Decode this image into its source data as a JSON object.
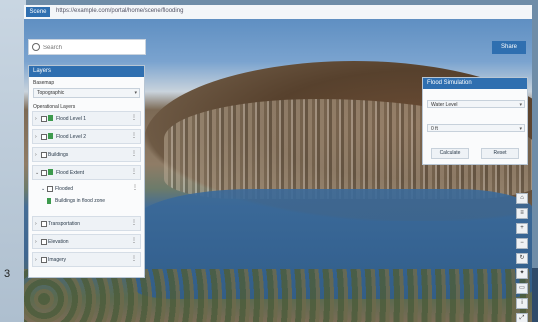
{
  "page_number": "3",
  "browser": {
    "nav_chip": "Scene",
    "url": "https://example.com/portal/home/scene/flooding"
  },
  "search": {
    "placeholder": "Search",
    "value": ""
  },
  "layers_panel": {
    "title": "Layers",
    "basemap_label": "Basemap",
    "basemap_value": "Topographic",
    "operational_label": "Operational Layers",
    "layers": [
      {
        "label": "Flood Level 1"
      },
      {
        "label": "Flood Level 2"
      },
      {
        "label": "Buildings"
      },
      {
        "label": "Flood Extent"
      }
    ],
    "sublayer": {
      "label": "Flooded"
    },
    "legend_text": "Buildings in flood zone",
    "more_layers": [
      {
        "label": "Transportation"
      },
      {
        "label": "Elevation"
      },
      {
        "label": "Imagery"
      }
    ]
  },
  "top_button": {
    "label": "Share"
  },
  "right_panel": {
    "title": "Flood Simulation",
    "select_1": "Water Level",
    "select_2": "0 ft",
    "button_left": "Calculate",
    "button_right": "Reset"
  },
  "toolbar": {
    "items": [
      {
        "icon": "home-icon",
        "glyph": "⌂"
      },
      {
        "icon": "layers-icon",
        "glyph": "≡"
      },
      {
        "icon": "zoom-in-icon",
        "glyph": "+"
      },
      {
        "icon": "zoom-out-icon",
        "glyph": "−"
      },
      {
        "icon": "rotate-icon",
        "glyph": "↻"
      },
      {
        "icon": "compass-icon",
        "glyph": "✦"
      },
      {
        "icon": "measure-icon",
        "glyph": "▭"
      },
      {
        "icon": "info-icon",
        "glyph": "i"
      },
      {
        "icon": "fullscreen-icon",
        "glyph": "⤢"
      }
    ]
  }
}
